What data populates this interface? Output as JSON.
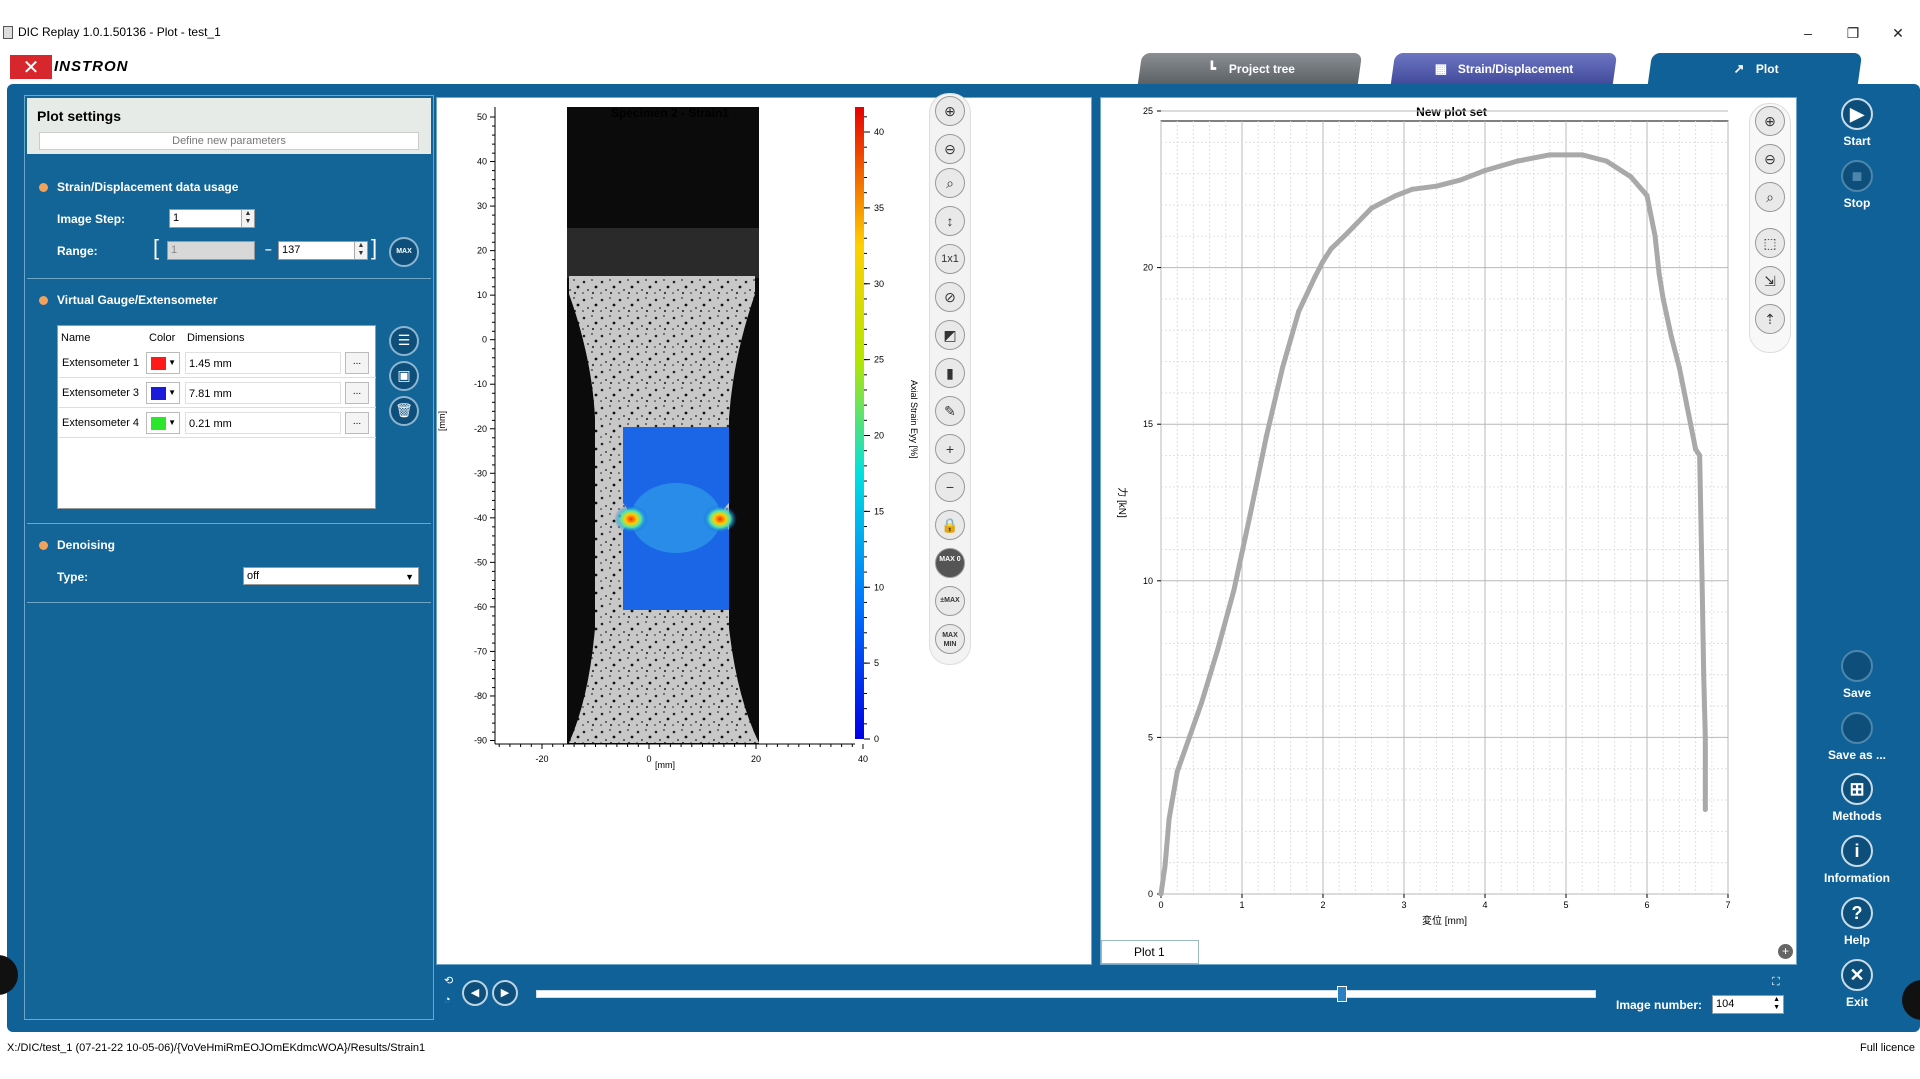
{
  "window": {
    "title": "DIC Replay 1.0.1.50136 - Plot - test_1",
    "minimize": "–",
    "maximize": "❐",
    "close": "✕"
  },
  "brand": {
    "mark": "✕",
    "name": "INSTRON",
    "color": "#d7262c"
  },
  "tabs": [
    {
      "label": "Project tree",
      "icon": "tree-icon"
    },
    {
      "label": "Strain/Displacement",
      "icon": "calculator-icon"
    },
    {
      "label": "Plot",
      "icon": "chart-icon"
    }
  ],
  "settings": {
    "title": "Plot settings",
    "define_button": "Define new parameters",
    "strain_section": "Strain/Displacement data usage",
    "image_step_label": "Image Step:",
    "image_step_value": "1",
    "range_label": "Range:",
    "range_from": "1",
    "range_to": "137",
    "range_dash": "–",
    "max_button": "MAX",
    "gauge_section": "Virtual Gauge/Extensometer",
    "table_headers": [
      "Name",
      "Color",
      "Dimensions"
    ],
    "extensometers": [
      {
        "name": "Extensometer 1",
        "color": "#ff1a1a",
        "dimension": "1.45 mm"
      },
      {
        "name": "Extensometer 3",
        "color": "#1b1bdc",
        "dimension": "7.81 mm"
      },
      {
        "name": "Extensometer 4",
        "color": "#2ce62c",
        "dimension": "0.21 mm"
      }
    ],
    "denoise_section": "Denoising",
    "type_label": "Type:",
    "type_value": "off",
    "more_button": "..."
  },
  "image_view": {
    "title": "Specimen 2 - Strain1",
    "y_axis_label": "[mm]",
    "x_axis_label": "[mm]",
    "y_ticks": [
      "50",
      "40",
      "30",
      "20",
      "10",
      "0",
      "-10",
      "-20",
      "-30",
      "-40",
      "-50",
      "-60",
      "-70",
      "-80",
      "-90"
    ],
    "x_ticks": [
      "-20",
      "0",
      "20",
      "40"
    ],
    "colorbar_ticks": [
      "40",
      "35",
      "30",
      "25",
      "20",
      "15",
      "10",
      "5",
      "0"
    ],
    "colorbar_label": "Axial Strain Eyy [%]",
    "tool_labels": {
      "one_to_one": "1x1",
      "max0": "MAX 0",
      "pmmax": "±MAX",
      "maxmin": "MAX MIN"
    }
  },
  "chart_data": {
    "type": "line",
    "title": "New plot set",
    "xlabel": "変位 [mm]",
    "ylabel": "力 [kN]",
    "xlim": [
      0,
      7
    ],
    "ylim": [
      0,
      25
    ],
    "x_ticks": [
      0,
      1,
      2,
      3,
      4,
      5,
      6,
      7
    ],
    "y_ticks": [
      0,
      5,
      10,
      15,
      20,
      25
    ],
    "grid": true,
    "series": [
      {
        "color": "#a9a9a9",
        "x": [
          0.0,
          0.05,
          0.1,
          0.2,
          0.35,
          0.5,
          0.7,
          0.9,
          1.1,
          1.3,
          1.5,
          1.7,
          1.9,
          2.0,
          2.1,
          2.3,
          2.6,
          2.9,
          3.1,
          3.4,
          3.7,
          4.0,
          4.4,
          4.8,
          5.2,
          5.5,
          5.8,
          6.0,
          6.1,
          6.15,
          6.2,
          6.3,
          6.4,
          6.5,
          6.6,
          6.65,
          6.68,
          6.7,
          6.72,
          6.72,
          6.72
        ],
        "y": [
          0.0,
          0.9,
          2.4,
          3.9,
          5.0,
          6.1,
          7.8,
          9.7,
          12.1,
          14.6,
          16.8,
          18.6,
          19.7,
          20.2,
          20.6,
          21.1,
          21.9,
          22.3,
          22.5,
          22.6,
          22.8,
          23.1,
          23.4,
          23.6,
          23.6,
          23.4,
          22.9,
          22.3,
          21.0,
          19.8,
          19.0,
          17.8,
          16.8,
          15.5,
          14.2,
          14.0,
          10.0,
          7.0,
          5.0,
          3.5,
          2.7
        ]
      }
    ]
  },
  "plot_view": {
    "tab_label": "Plot 1",
    "add_icon": "+"
  },
  "player": {
    "image_number_label": "Image number:",
    "image_number": "104",
    "position_fraction": 0.76
  },
  "actions": [
    {
      "label": "Start",
      "icon": "play-icon",
      "glyph": "▶",
      "enabled": true
    },
    {
      "label": "Stop",
      "icon": "stop-icon",
      "glyph": "■",
      "enabled": false
    },
    {
      "label": "Save",
      "icon": "save-icon",
      "glyph": "",
      "enabled": false
    },
    {
      "label": "Save as ...",
      "icon": "save-as-icon",
      "glyph": "",
      "enabled": false
    },
    {
      "label": "Methods",
      "icon": "methods-icon",
      "glyph": "⊞",
      "enabled": true
    },
    {
      "label": "Information",
      "icon": "info-icon",
      "glyph": "i",
      "enabled": true
    },
    {
      "label": "Help",
      "icon": "help-icon",
      "glyph": "?",
      "enabled": true
    },
    {
      "label": "Exit",
      "icon": "exit-icon",
      "glyph": "✕",
      "enabled": true
    }
  ],
  "status": {
    "path": "X:/DIC/test_1 (07-21-22 10-05-06)/{VoVeHmiRmEOJOmEKdmcWOA}/Results/Strain1",
    "licence": "Full licence"
  }
}
